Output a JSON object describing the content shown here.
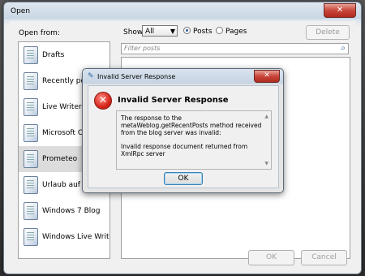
{
  "window": {
    "title": "Open",
    "close_glyph": "✕"
  },
  "open_from": {
    "label": "Open from:",
    "items": [
      {
        "label": "Drafts",
        "icon": "document-icon"
      },
      {
        "label": "Recently posted",
        "icon": "recent-icon"
      },
      {
        "label": "Live Writer Blog E",
        "icon": "blog-icon"
      },
      {
        "label": "Microsoft Office",
        "icon": "blog-icon"
      },
      {
        "label": "Prometeo",
        "icon": "blog-icon",
        "selected": true
      },
      {
        "label": "Urlaub auf Solta",
        "icon": "blog-icon"
      },
      {
        "label": "Windows 7 Blog",
        "icon": "blog-icon"
      },
      {
        "label": "Windows Live Writer Blog",
        "icon": "blog-icon"
      }
    ]
  },
  "toolbar": {
    "show_label": "Show:",
    "show_value": "All",
    "radio_posts": "Posts",
    "radio_pages": "Pages",
    "selected_radio": "Posts",
    "delete_label": "Delete"
  },
  "filter": {
    "placeholder": "Filter posts"
  },
  "footer": {
    "ok_label": "OK",
    "cancel_label": "Cancel"
  },
  "dialog": {
    "title": "Invalid Server Response",
    "close_glyph": "✕",
    "heading": "Invalid Server Response",
    "error_glyph": "✕",
    "message_line1": "The response to the metaWeblog.getRecentPosts method received from the blog server was invalid:",
    "message_line2": "Invalid response document returned from XmlRpc server",
    "ok_label": "OK"
  },
  "colors": {
    "error_red": "#d6261b",
    "selection_gray": "#dcdcdc",
    "accent_blue": "#3c7fb1"
  }
}
